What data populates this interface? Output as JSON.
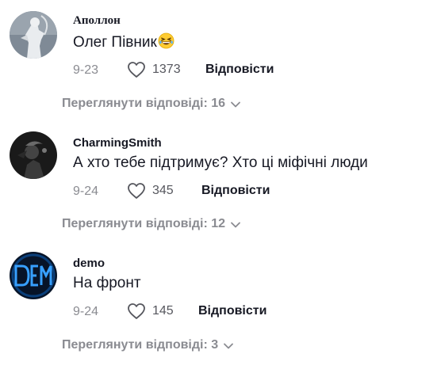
{
  "comments": [
    {
      "author": "Аполлон",
      "text": "Олег Півник",
      "emoji": "grinning-squinting-face-emoji",
      "date": "9-23",
      "likes": "1373",
      "reply_label": "Відповісти",
      "view_replies": "Переглянути відповіді: 16"
    },
    {
      "author": "CharmingSmith",
      "text": "А хто тебе підтримує? Хто ці міфічні люди",
      "date": "9-24",
      "likes": "345",
      "reply_label": "Відповісти",
      "view_replies": "Переглянути відповіді: 12"
    },
    {
      "author": "demo",
      "text": "На фронт",
      "date": "9-24",
      "likes": "145",
      "reply_label": "Відповісти",
      "view_replies": "Переглянути відповіді: 3"
    }
  ],
  "icons": {
    "like": "heart-outline-icon",
    "expand": "chevron-down-icon"
  },
  "colors": {
    "text": "#161823",
    "muted": "#8a8b91",
    "avatar_blue": "#1e90ff"
  }
}
